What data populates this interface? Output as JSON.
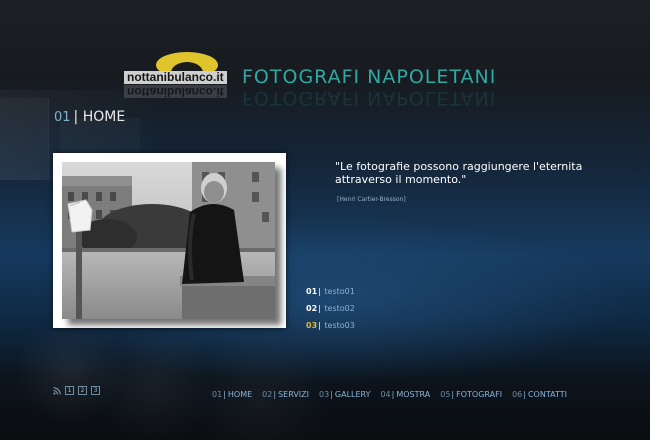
{
  "brand": {
    "logo_text": "nottanibulanco.it",
    "site_title": "FOTOGRAFI NAPOLETANI"
  },
  "section": {
    "number": "01",
    "separator": "|",
    "title": "HOME"
  },
  "quote": {
    "text": "\"Le fotografie possono raggiungere l'eternita attraverso il momento.\"",
    "author": "[Henri Cartier-Bresson]"
  },
  "sublinks": [
    {
      "number": "01",
      "label": "testo01"
    },
    {
      "number": "02",
      "label": "testo02"
    },
    {
      "number": "03",
      "label": "testo03"
    }
  ],
  "pager": {
    "icon": "rss-icon",
    "pages": [
      "1",
      "2",
      "3"
    ]
  },
  "nav": [
    {
      "number": "01",
      "label": "HOME"
    },
    {
      "number": "02",
      "label": "SERVIZI"
    },
    {
      "number": "03",
      "label": "GALLERY"
    },
    {
      "number": "04",
      "label": "MOSTRA"
    },
    {
      "number": "05",
      "label": "FOTOGRAFI"
    },
    {
      "number": "06",
      "label": "CONTATTI"
    }
  ],
  "colors": {
    "accent_teal": "#2fa9a2",
    "accent_gold": "#e2b93b",
    "link_blue": "#8ab5d8"
  }
}
